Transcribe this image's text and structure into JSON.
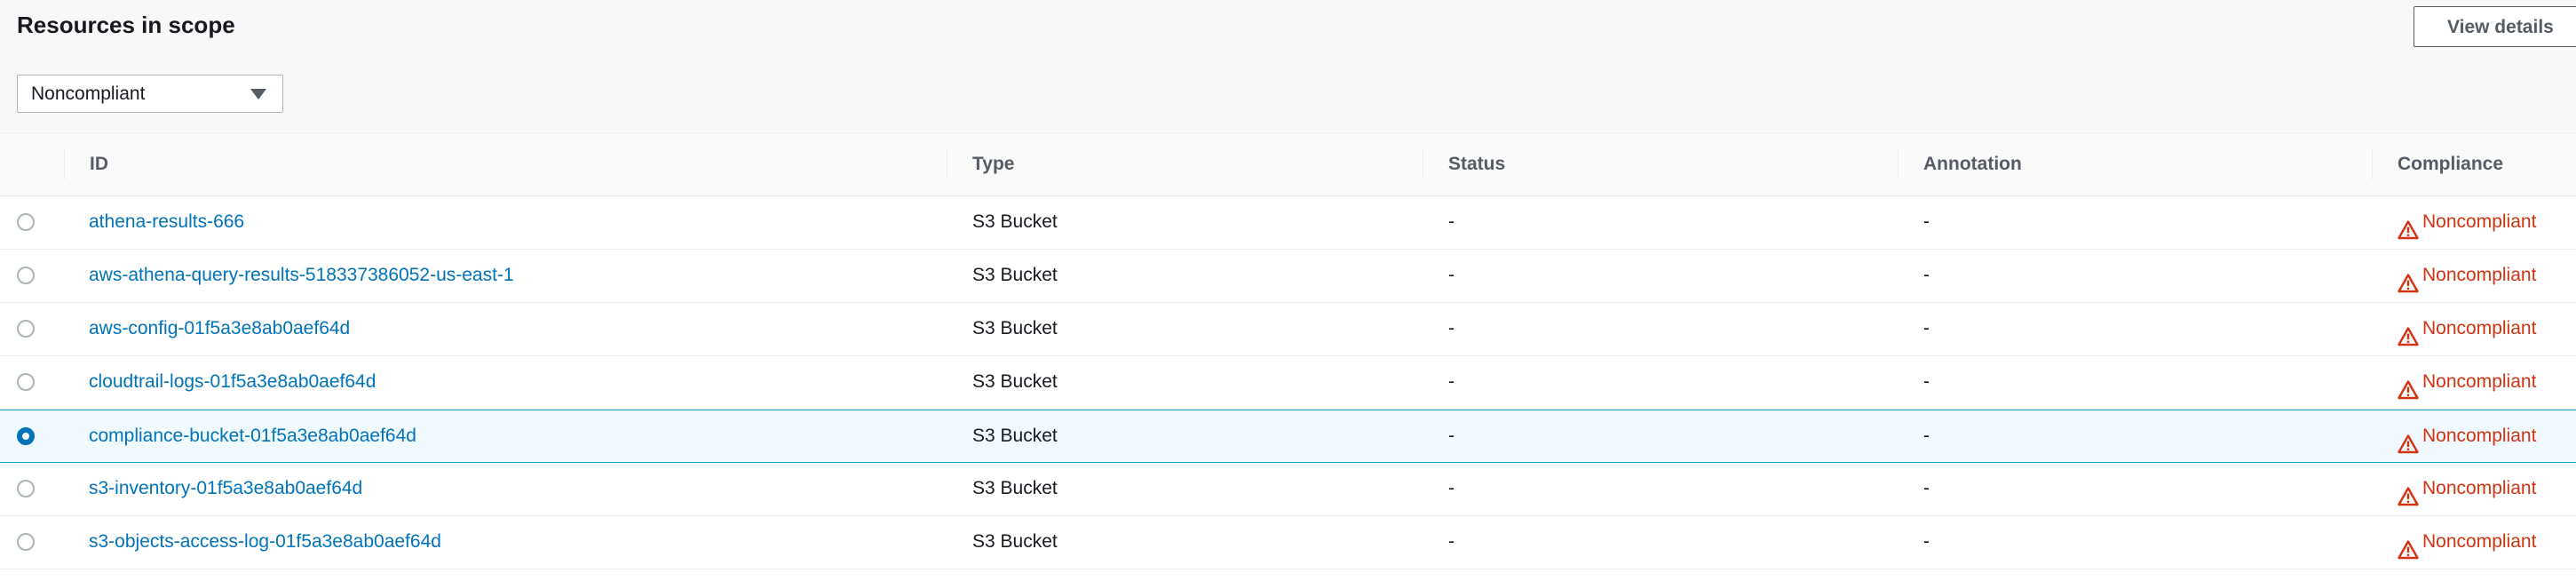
{
  "header": {
    "title": "Resources in scope",
    "view_details_label": "View details"
  },
  "filter": {
    "selected": "Noncompliant"
  },
  "table": {
    "columns": [
      "ID",
      "Type",
      "Status",
      "Annotation",
      "Compliance"
    ],
    "rows": [
      {
        "id": "athena-results-666",
        "type": "S3 Bucket",
        "status": "-",
        "annotation": "-",
        "compliance": "Noncompliant",
        "selected": false
      },
      {
        "id": "aws-athena-query-results-518337386052-us-east-1",
        "type": "S3 Bucket",
        "status": "-",
        "annotation": "-",
        "compliance": "Noncompliant",
        "selected": false
      },
      {
        "id": "aws-config-01f5a3e8ab0aef64d",
        "type": "S3 Bucket",
        "status": "-",
        "annotation": "-",
        "compliance": "Noncompliant",
        "selected": false
      },
      {
        "id": "cloudtrail-logs-01f5a3e8ab0aef64d",
        "type": "S3 Bucket",
        "status": "-",
        "annotation": "-",
        "compliance": "Noncompliant",
        "selected": false
      },
      {
        "id": "compliance-bucket-01f5a3e8ab0aef64d",
        "type": "S3 Bucket",
        "status": "-",
        "annotation": "-",
        "compliance": "Noncompliant",
        "selected": true
      },
      {
        "id": "s3-inventory-01f5a3e8ab0aef64d",
        "type": "S3 Bucket",
        "status": "-",
        "annotation": "-",
        "compliance": "Noncompliant",
        "selected": false
      },
      {
        "id": "s3-objects-access-log-01f5a3e8ab0aef64d",
        "type": "S3 Bucket",
        "status": "-",
        "annotation": "-",
        "compliance": "Noncompliant",
        "selected": false
      }
    ]
  },
  "icons": {
    "compliance_icon": "warning-triangle-icon",
    "filter_caret": "caret-down-icon"
  },
  "colors": {
    "link": "#0073bb",
    "noncompliant": "#d13212",
    "selected_row_bg": "#f1faff",
    "selected_row_border": "#00a1c9"
  }
}
